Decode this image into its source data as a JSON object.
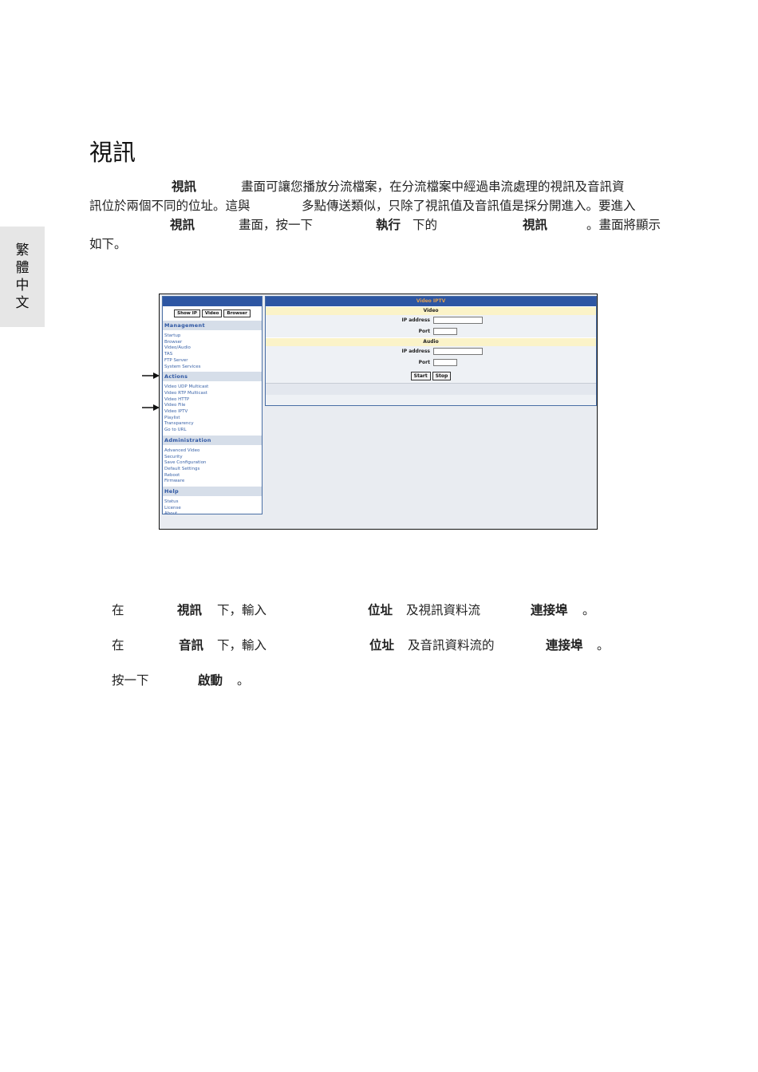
{
  "side_tab": [
    "繁",
    "體",
    "中",
    "文"
  ],
  "title": "視訊",
  "paragraph": {
    "line1": {
      "t1": "視訊",
      "t2": "畫面可讓您播放分流檔案，在分流檔案中經過串流處理的視訊及音訊資"
    },
    "line2": {
      "t1": "訊位於兩個不同的位址。這與",
      "t2": "多點傳送類似，只除了視訊值及音訊值是採分開進入。要進入"
    },
    "line3": {
      "t1": "視訊",
      "t2": "畫面，按一下",
      "t3": "執行",
      "t4": "下的",
      "t5": "視訊",
      "t6": "。畫面將顯示"
    },
    "line4": "如下。"
  },
  "screenshot": {
    "nav_buttons": [
      "Show IP",
      "Video",
      "Browser"
    ],
    "sections": [
      {
        "heading": "Management",
        "items": [
          "Startup",
          "Browser",
          "Video/Audio",
          "TAS",
          "FTP Server",
          "System Services"
        ]
      },
      {
        "heading": "Actions",
        "items": [
          "Video UDP Multicast",
          "Video RTP Multicast",
          "Video HTTP",
          "Video File",
          "Video IPTV",
          "Playlist",
          "Transparency",
          "Go to URL"
        ]
      },
      {
        "heading": "Administration",
        "items": [
          "Advanced Video",
          "Security",
          "Save Configuration",
          "Default Settings",
          "Reboot",
          "Firmware"
        ]
      },
      {
        "heading": "Help",
        "items": [
          "Status",
          "License",
          "About"
        ]
      }
    ],
    "main_title": "Video IPTV",
    "video_label": "Video",
    "audio_label": "Audio",
    "ip_label": "IP address",
    "port_label": "Port",
    "start_label": "Start",
    "stop_label": "Stop"
  },
  "steps": [
    {
      "s1": "在",
      "s2": "視訊",
      "s3": "下，輸入",
      "s4": "位址",
      "s5": "及視訊資料流",
      "s6": "連接埠",
      "s7": "。"
    },
    {
      "s1": "在",
      "s2": "音訊",
      "s3": "下，輸入",
      "s4": "位址",
      "s5": "及音訊資料流的",
      "s6": "連接埠",
      "s7": "。"
    },
    {
      "s1": "按一下",
      "s2": "啟動",
      "s3": "。"
    }
  ]
}
